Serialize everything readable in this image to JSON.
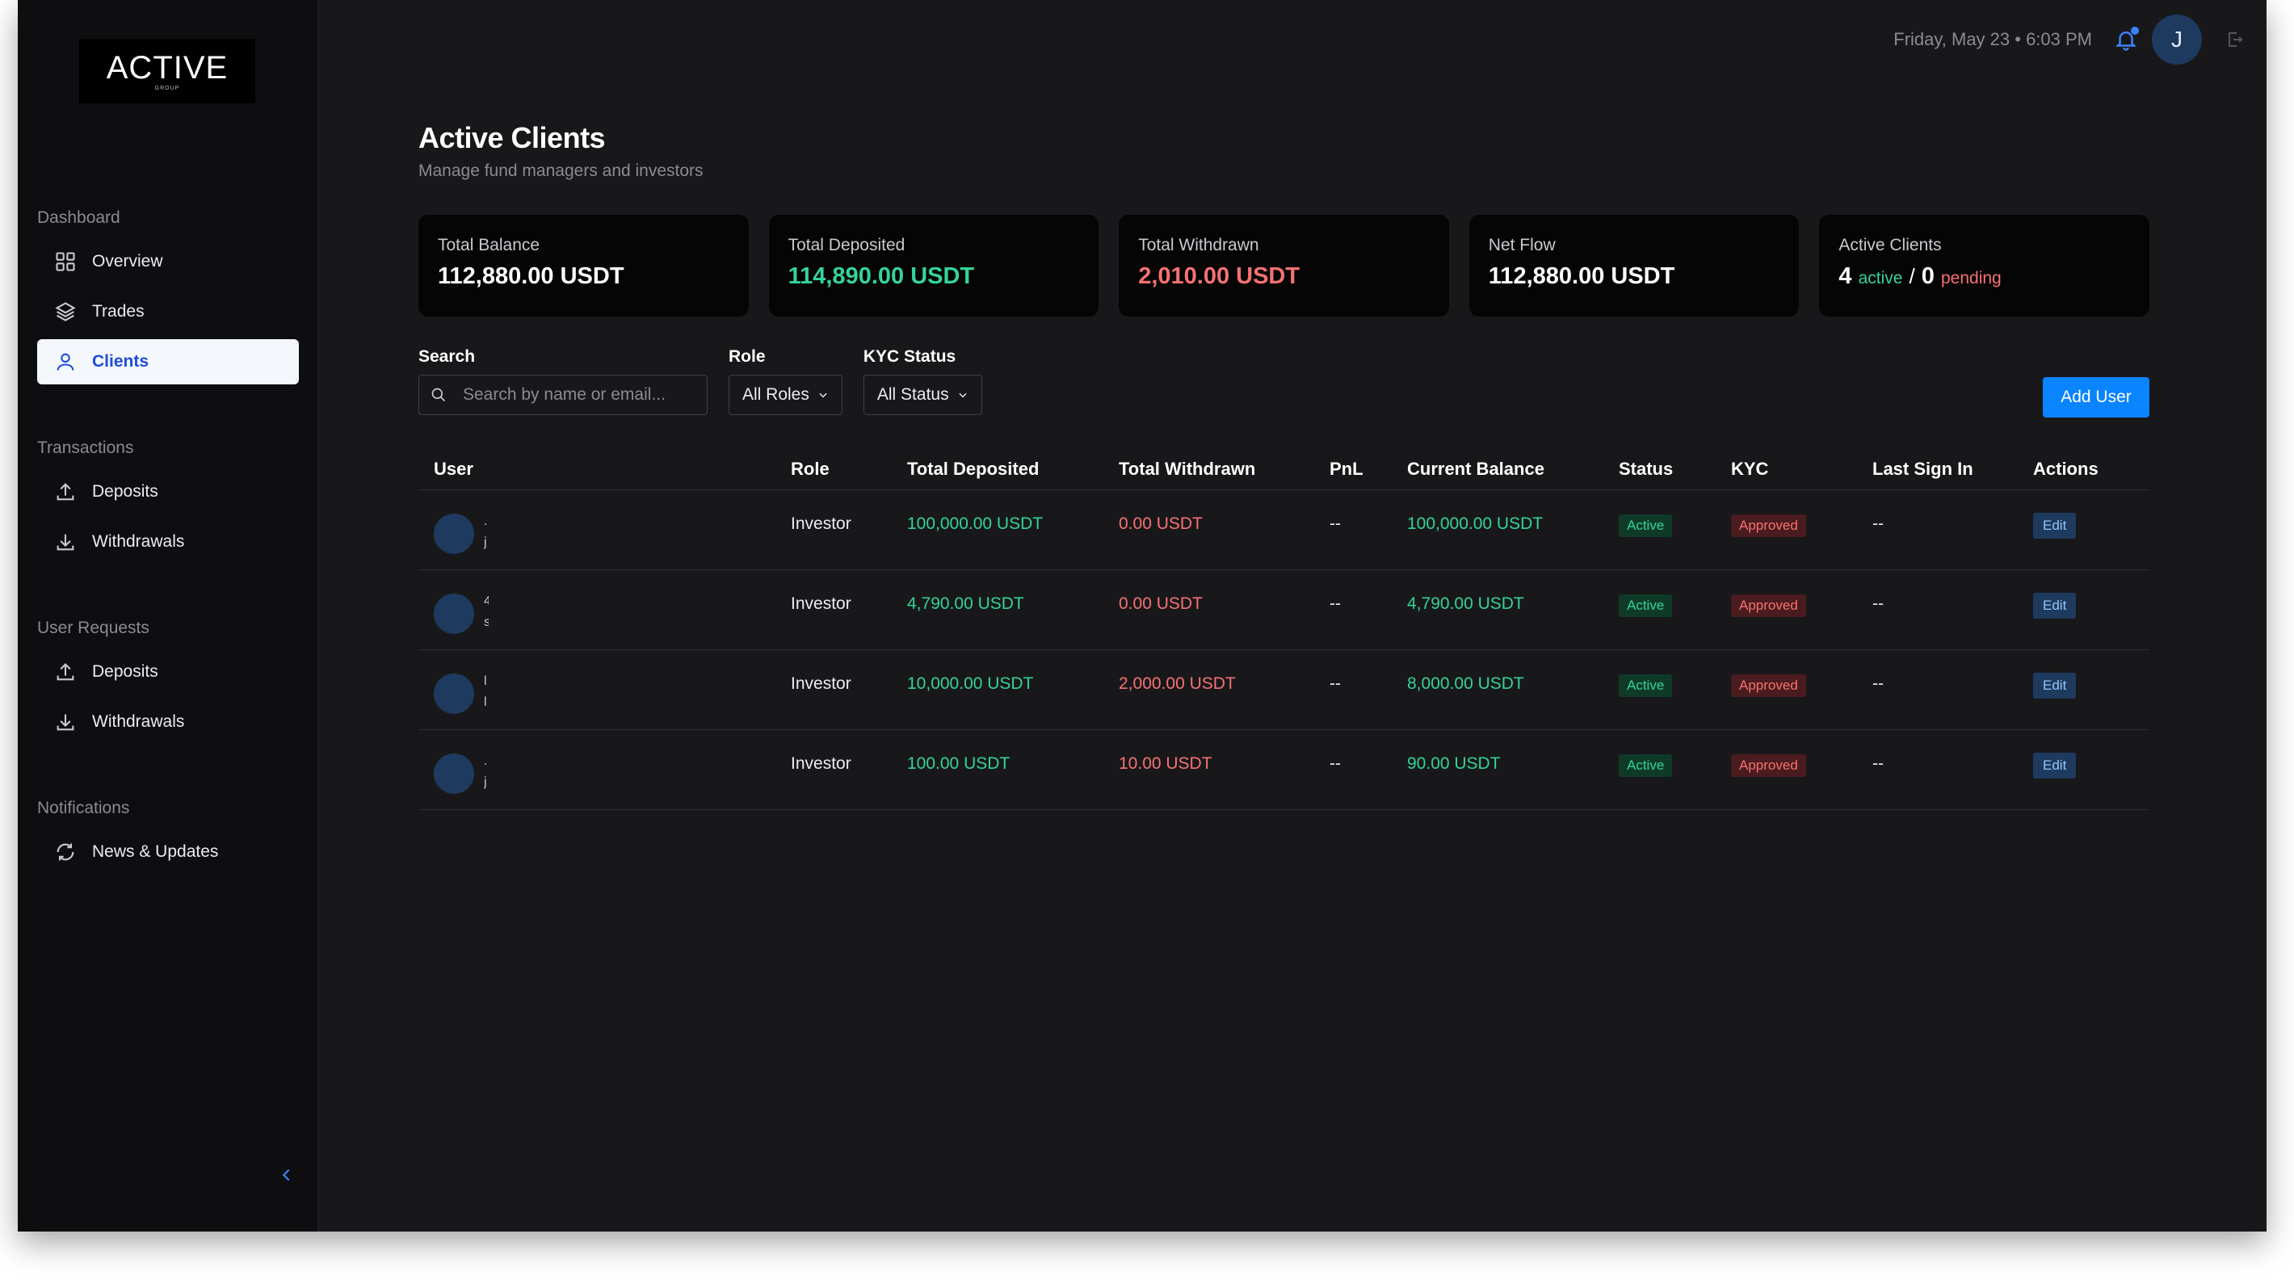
{
  "app": {
    "logo_word": "ACTIVE",
    "logo_sub": "GROUP",
    "datetime": "Friday, May 23 • 6:03 PM",
    "user_initial": "J"
  },
  "sidebar": {
    "sections": [
      {
        "heading": "Dashboard",
        "items": [
          {
            "label": "Overview",
            "icon": "grid-icon"
          },
          {
            "label": "Trades",
            "icon": "layers-icon"
          },
          {
            "label": "Clients",
            "icon": "user-icon",
            "active": true
          }
        ]
      },
      {
        "heading": "Transactions",
        "items": [
          {
            "label": "Deposits",
            "icon": "upload-icon"
          },
          {
            "label": "Withdrawals",
            "icon": "download-icon"
          }
        ]
      },
      {
        "heading": "User Requests",
        "items": [
          {
            "label": "Deposits",
            "icon": "upload-icon"
          },
          {
            "label": "Withdrawals",
            "icon": "download-icon"
          }
        ]
      },
      {
        "heading": "Notifications",
        "items": [
          {
            "label": "News & Updates",
            "icon": "refresh-icon"
          }
        ]
      }
    ]
  },
  "page": {
    "title": "Active Clients",
    "subtitle": "Manage fund managers and investors"
  },
  "cards": [
    {
      "label": "Total Balance",
      "value": "112,880.00 USDT",
      "color": "#ffffff"
    },
    {
      "label": "Total Deposited",
      "value": "114,890.00 USDT",
      "color": "#34d399"
    },
    {
      "label": "Total Withdrawn",
      "value": "2,010.00 USDT",
      "color": "#f87171"
    },
    {
      "label": "Net Flow",
      "value": "112,880.00 USDT",
      "color": "#ffffff"
    },
    {
      "label": "Active Clients",
      "active_count": "4",
      "active_word": "active",
      "separator": "/",
      "pending_count": "0",
      "pending_word": "pending"
    }
  ],
  "filters": {
    "search_label": "Search",
    "search_placeholder": "Search by name or email...",
    "role_label": "Role",
    "role_value": "All Roles",
    "kyc_label": "KYC Status",
    "kyc_value": "All Status"
  },
  "add_user_label": "Add User",
  "table": {
    "columns": [
      "User",
      "Role",
      "Total Deposited",
      "Total Withdrawn",
      "PnL",
      "Current Balance",
      "Status",
      "KYC",
      "Last Sign In",
      "Actions"
    ],
    "rows": [
      {
        "user_line1": ".",
        "user_line2": "j",
        "role": "Investor",
        "deposited": "100,000.00 USDT",
        "withdrawn": "0.00 USDT",
        "pnl": "--",
        "balance": "100,000.00 USDT",
        "status": "Active",
        "kyc": "Approved",
        "last_sign_in": "--",
        "action": "Edit"
      },
      {
        "user_line1": "4",
        "user_line2": "s",
        "role": "Investor",
        "deposited": "4,790.00 USDT",
        "withdrawn": "0.00 USDT",
        "pnl": "--",
        "balance": "4,790.00 USDT",
        "status": "Active",
        "kyc": "Approved",
        "last_sign_in": "--",
        "action": "Edit"
      },
      {
        "user_line1": "l",
        "user_line2": "l",
        "role": "Investor",
        "deposited": "10,000.00 USDT",
        "withdrawn": "2,000.00 USDT",
        "pnl": "--",
        "balance": "8,000.00 USDT",
        "status": "Active",
        "kyc": "Approved",
        "last_sign_in": "--",
        "action": "Edit"
      },
      {
        "user_line1": ".",
        "user_line2": "j",
        "role": "Investor",
        "deposited": "100.00 USDT",
        "withdrawn": "10.00 USDT",
        "pnl": "--",
        "balance": "90.00 USDT",
        "status": "Active",
        "kyc": "Approved",
        "last_sign_in": "--",
        "action": "Edit"
      }
    ]
  }
}
